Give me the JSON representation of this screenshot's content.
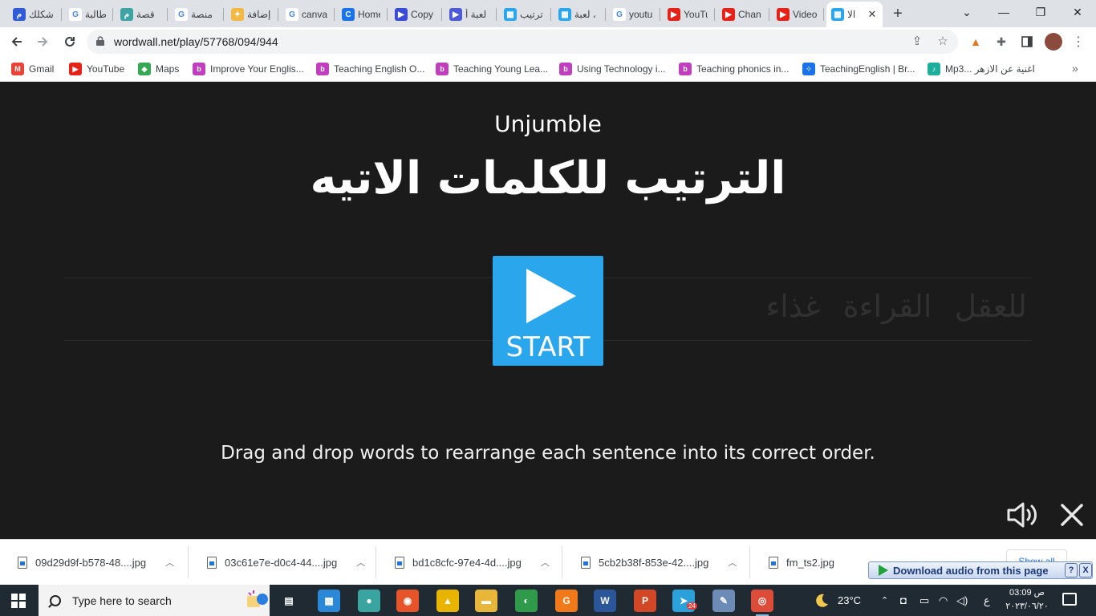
{
  "browser": {
    "tabs": [
      {
        "title": "شكلك",
        "icon": "mawdoo-icon",
        "color": "#2f5bd8",
        "glyph": "م"
      },
      {
        "title": "طالبة",
        "icon": "google-icon",
        "color": "#ffffff",
        "glyph": "G"
      },
      {
        "title": "قصة",
        "icon": "mawdoo3-icon",
        "color": "#3ea3a3",
        "glyph": "م"
      },
      {
        "title": "منصة",
        "icon": "google-icon",
        "color": "#ffffff",
        "glyph": "G"
      },
      {
        "title": "إضافة",
        "icon": "star-icon",
        "color": "#f5b942",
        "glyph": "✦"
      },
      {
        "title": "canva",
        "icon": "google-icon",
        "color": "#ffffff",
        "glyph": "G"
      },
      {
        "title": "Home",
        "icon": "canva-icon",
        "color": "#1a73e8",
        "glyph": "C"
      },
      {
        "title": "Copy",
        "icon": "zoom-icon",
        "color": "#3a4bd8",
        "glyph": "▶"
      },
      {
        "title": "لعبة أ",
        "icon": "video-icon",
        "color": "#4b5bd8",
        "glyph": "▶"
      },
      {
        "title": "ترتيب",
        "icon": "wordwall-icon",
        "color": "#2aa6ec",
        "glyph": "▦"
      },
      {
        "title": "لعبة ،",
        "icon": "wordwall-icon",
        "color": "#2aa6ec",
        "glyph": "▦"
      },
      {
        "title": "youtu",
        "icon": "google-icon",
        "color": "#ffffff",
        "glyph": "G"
      },
      {
        "title": "YouTu",
        "icon": "youtube-icon",
        "color": "#e62117",
        "glyph": "▶"
      },
      {
        "title": "Chan",
        "icon": "youtube-icon",
        "color": "#e62117",
        "glyph": "▶"
      },
      {
        "title": "Video",
        "icon": "youtube-icon",
        "color": "#e62117",
        "glyph": "▶"
      },
      {
        "title": "الا",
        "icon": "wordwall-icon",
        "color": "#2aa6ec",
        "glyph": "▦",
        "active": true
      }
    ],
    "url": "wordwall.net/play/57768/094/944",
    "bookmarks": [
      {
        "label": "Gmail",
        "icon": "gmail-icon",
        "color": "#ea4335",
        "glyph": "M"
      },
      {
        "label": "YouTube",
        "icon": "youtube-icon",
        "color": "#e62117",
        "glyph": "▶"
      },
      {
        "label": "Maps",
        "icon": "maps-icon",
        "color": "#34a853",
        "glyph": "◆"
      },
      {
        "label": "Improve Your Englis...",
        "icon": "british-council-icon",
        "color": "#c13fbf",
        "glyph": "b"
      },
      {
        "label": "Teaching English O...",
        "icon": "british-council-icon",
        "color": "#c13fbf",
        "glyph": "b"
      },
      {
        "label": "Teaching Young Lea...",
        "icon": "british-council-icon",
        "color": "#c13fbf",
        "glyph": "b"
      },
      {
        "label": "Using Technology i...",
        "icon": "british-council-icon",
        "color": "#c13fbf",
        "glyph": "b"
      },
      {
        "label": "Teaching phonics in...",
        "icon": "british-council-icon",
        "color": "#c13fbf",
        "glyph": "b"
      },
      {
        "label": "TeachingEnglish | Br...",
        "icon": "teachingenglish-icon",
        "color": "#1a73e8",
        "glyph": "⁘"
      },
      {
        "label": "Mp3... اغنية عن الازهر",
        "icon": "mp3-icon",
        "color": "#1fae9b",
        "glyph": "♪"
      }
    ]
  },
  "game": {
    "type": "Unjumble",
    "title": "الترتيب للكلمات الاتيه",
    "background_words": "للعقل القراءة غذاء",
    "start_label": "START",
    "instructions": "Drag and drop words to rearrange each sentence into its correct order."
  },
  "downloads": {
    "items": [
      "09d29d9f-b578-48....jpg",
      "03c61e7e-d0c4-44....jpg",
      "bd1c8cfc-97e4-4d....jpg",
      "5cb2b38f-853e-42....jpg",
      "fm_ts2.jpg"
    ],
    "show_all": "Show all",
    "audio_popup": "Download audio from this page",
    "audio_help": "?",
    "audio_close": "X"
  },
  "taskbar": {
    "search_placeholder": "Type here to search",
    "weather": "23°C",
    "lang": "ع",
    "time": "03:09 ص",
    "date": "٢٠٢٣/٠٦/٢٠",
    "apps": [
      {
        "icon": "task-view-icon",
        "color": "#1f2a33",
        "glyph": "▤"
      },
      {
        "icon": "microsoft-store-icon",
        "color": "#2b88d8",
        "glyph": "▦"
      },
      {
        "icon": "profile-app-icon",
        "color": "#3aa5a0",
        "glyph": "●"
      },
      {
        "icon": "firefox-icon",
        "color": "#e8542a",
        "glyph": "◉"
      },
      {
        "icon": "alp-app-icon",
        "color": "#e8b400",
        "glyph": "▲"
      },
      {
        "icon": "file-explorer-icon",
        "color": "#e8b73a",
        "glyph": "▬"
      },
      {
        "icon": "earth-app-icon",
        "color": "#2f9b4a",
        "glyph": "◐"
      },
      {
        "icon": "pdf-app-icon",
        "color": "#f07a1a",
        "glyph": "G"
      },
      {
        "icon": "word-icon",
        "color": "#2b579a",
        "glyph": "W"
      },
      {
        "icon": "powerpoint-icon",
        "color": "#d24726",
        "glyph": "P"
      },
      {
        "icon": "telegram-icon",
        "color": "#2aa1da",
        "glyph": "➤",
        "badge": "24"
      },
      {
        "icon": "paint-icon",
        "color": "#6d8bb7",
        "glyph": "✎"
      },
      {
        "icon": "chrome-icon",
        "color": "#dd4b39",
        "glyph": "◎",
        "running": true
      }
    ]
  }
}
